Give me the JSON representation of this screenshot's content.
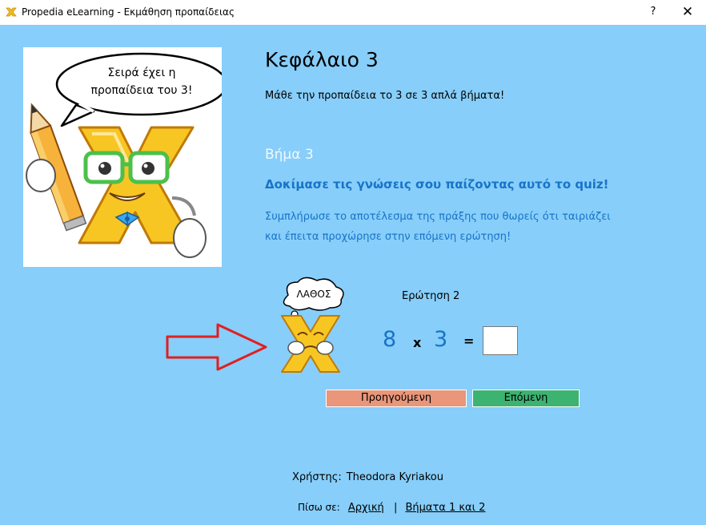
{
  "window": {
    "title": "Propedia eLearning - Εκμάθηση προπαίδειας",
    "help_glyph": "?",
    "close_glyph": "✕"
  },
  "hero": {
    "speech_line1": "Σειρά έχει η",
    "speech_line2": "προπαίδεια του 3!"
  },
  "header": {
    "title": "Κεφάλαιο 3",
    "subtitle": "Μάθε την προπαίδεια το 3 σε 3 απλά βήματα!"
  },
  "step": {
    "label": "Βήμα 3",
    "heading": "Δοκίμασε τις γνώσεις σου παίζοντας αυτό το quiz!",
    "desc_line1": "Συμπλήρωσε το αποτέλεσμα της πράξης που θωρείς ότι ταιριάζει",
    "desc_line2": "και έπειτα προχώρησε στην επόμενη ερώτηση!"
  },
  "quiz": {
    "feedback": "ΛΑΘΟΣ",
    "question_label": "Ερώτηση 2",
    "operand1": "8",
    "operator": "x",
    "operand2": "3",
    "equals": "=",
    "answer_value": ""
  },
  "nav": {
    "prev_label": "Προηγούμενη",
    "next_label": "Επόμενη"
  },
  "user": {
    "label": "Χρήστης:",
    "name": "Theodora Kyriakou"
  },
  "footer": {
    "back_label": "Πίσω σε:",
    "home_link": "Αρχική",
    "separator": "|",
    "steps_link": "Βήματα 1 και 2"
  },
  "colors": {
    "background": "#87CEFA",
    "accent": "#1873C8",
    "prev_button": "#E9967A",
    "next_button": "#3CB371",
    "arrow": "#E02020"
  },
  "icons": {
    "app": "app-x-logo-icon",
    "hero": "x-mascot-with-pencil",
    "arrow": "red-arrow-icon",
    "mascot": "x-mascot-sad"
  }
}
